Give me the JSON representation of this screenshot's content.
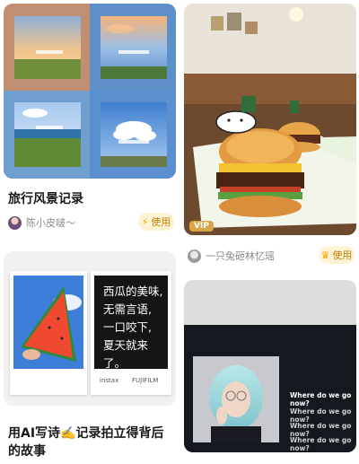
{
  "cards": [
    {
      "title": "旅行风景记录",
      "author": "陈小皮啵～",
      "use_label": "使用"
    },
    {
      "vip_badge": "VIP",
      "author": "一只兔砸林忆瑶",
      "use_label": "使用"
    },
    {
      "title": "用AI写诗✍️记录拍立得背后的故事",
      "poem_lines": [
        "西瓜的美味,",
        "无需言语,",
        "一口咬下,",
        "夏天就来了。"
      ],
      "brand_left": "instax",
      "brand_right": "FUJIFILM"
    },
    {
      "lyrics": [
        "Where do we go now?",
        "Where do we go now?",
        "Where do we go now?",
        "Where do we go now?"
      ]
    }
  ],
  "colors": {
    "use_bg": "#fff3d6",
    "use_text": "#c98000",
    "vip": "#d9a64a"
  }
}
